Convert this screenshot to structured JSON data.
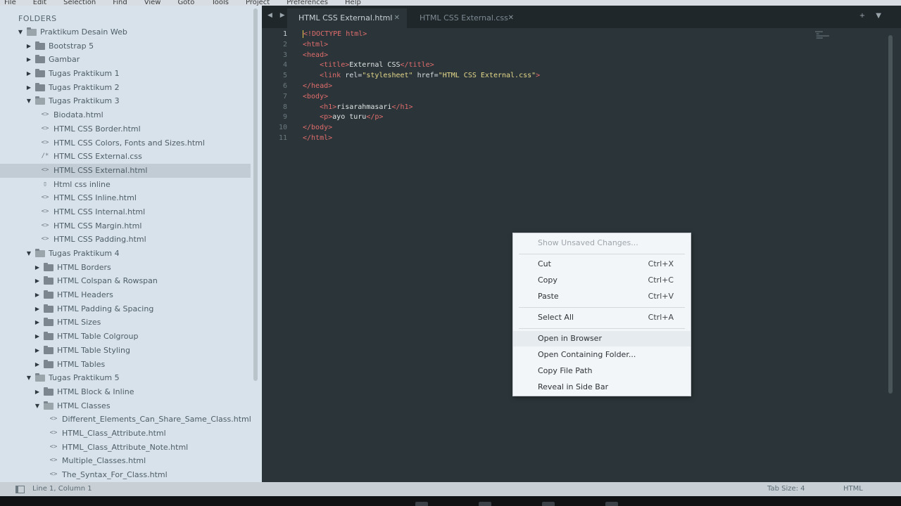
{
  "menubar": {
    "items": [
      "File",
      "Edit",
      "Selection",
      "Find",
      "View",
      "Goto",
      "Tools",
      "Project",
      "Preferences",
      "Help"
    ]
  },
  "sidebar": {
    "header": "FOLDERS",
    "tree": [
      {
        "label": "Praktikum Desain Web",
        "kind": "folder",
        "depth": 0,
        "open": true
      },
      {
        "label": "Bootstrap 5",
        "kind": "folder",
        "depth": 1,
        "open": false
      },
      {
        "label": "Gambar",
        "kind": "folder",
        "depth": 1,
        "open": false
      },
      {
        "label": "Tugas Praktikum 1",
        "kind": "folder",
        "depth": 1,
        "open": false
      },
      {
        "label": "Tugas Praktikum 2",
        "kind": "folder",
        "depth": 1,
        "open": false
      },
      {
        "label": "Tugas Praktikum 3",
        "kind": "folder",
        "depth": 1,
        "open": true
      },
      {
        "label": "Biodata.html",
        "kind": "html",
        "depth": 2
      },
      {
        "label": "HTML CSS Border.html",
        "kind": "html",
        "depth": 2
      },
      {
        "label": "HTML CSS Colors, Fonts and Sizes.html",
        "kind": "html",
        "depth": 2
      },
      {
        "label": "HTML CSS External.css",
        "kind": "css",
        "depth": 2
      },
      {
        "label": "HTML CSS External.html",
        "kind": "html",
        "depth": 2,
        "selected": true
      },
      {
        "label": "Html css inline",
        "kind": "plain",
        "depth": 2
      },
      {
        "label": "HTML CSS Inline.html",
        "kind": "html",
        "depth": 2
      },
      {
        "label": "HTML CSS Internal.html",
        "kind": "html",
        "depth": 2
      },
      {
        "label": "HTML CSS Margin.html",
        "kind": "html",
        "depth": 2
      },
      {
        "label": "HTML CSS Padding.html",
        "kind": "html",
        "depth": 2
      },
      {
        "label": "Tugas Praktikum 4",
        "kind": "folder",
        "depth": 1,
        "open": true
      },
      {
        "label": "HTML Borders",
        "kind": "folder",
        "depth": 2,
        "open": false
      },
      {
        "label": "HTML Colspan & Rowspan",
        "kind": "folder",
        "depth": 2,
        "open": false
      },
      {
        "label": "HTML Headers",
        "kind": "folder",
        "depth": 2,
        "open": false
      },
      {
        "label": "HTML Padding & Spacing",
        "kind": "folder",
        "depth": 2,
        "open": false
      },
      {
        "label": "HTML Sizes",
        "kind": "folder",
        "depth": 2,
        "open": false
      },
      {
        "label": "HTML Table Colgroup",
        "kind": "folder",
        "depth": 2,
        "open": false
      },
      {
        "label": "HTML Table Styling",
        "kind": "folder",
        "depth": 2,
        "open": false
      },
      {
        "label": "HTML Tables",
        "kind": "folder",
        "depth": 2,
        "open": false
      },
      {
        "label": "Tugas Praktikum 5",
        "kind": "folder",
        "depth": 1,
        "open": true
      },
      {
        "label": "HTML Block & Inline",
        "kind": "folder",
        "depth": 2,
        "open": false
      },
      {
        "label": "HTML Classes",
        "kind": "folder",
        "depth": 2,
        "open": true
      },
      {
        "label": "Different_Elements_Can_Share_Same_Class.html",
        "kind": "html",
        "depth": 3
      },
      {
        "label": "HTML_Class_Attribute.html",
        "kind": "html",
        "depth": 3
      },
      {
        "label": "HTML_Class_Attribute_Note.html",
        "kind": "html",
        "depth": 3
      },
      {
        "label": "Multiple_Classes.html",
        "kind": "html",
        "depth": 3
      },
      {
        "label": "The_Syntax_For_Class.html",
        "kind": "html",
        "depth": 3
      }
    ]
  },
  "tabs": {
    "nav_label": "◀ ▶",
    "right_label": "+ ▼",
    "items": [
      {
        "label": "HTML CSS External.html",
        "active": true
      },
      {
        "label": "HTML CSS External.css",
        "active": false
      }
    ]
  },
  "editor": {
    "current_line": 1,
    "lines": [
      [
        [
          "t",
          "<!DOCTYPE html>"
        ]
      ],
      [
        [
          "t",
          "<html>"
        ]
      ],
      [
        [
          "t",
          "<head>"
        ]
      ],
      [
        [
          "x",
          "    "
        ],
        [
          "t",
          "<title>"
        ],
        [
          "x",
          "External CSS"
        ],
        [
          "t",
          "</title>"
        ]
      ],
      [
        [
          "x",
          "    "
        ],
        [
          "t",
          "<link "
        ],
        [
          "a",
          "rel="
        ],
        [
          "s",
          "\"stylesheet\""
        ],
        [
          "a",
          " href="
        ],
        [
          "s",
          "\"HTML CSS External.css\""
        ],
        [
          "t",
          ">"
        ]
      ],
      [
        [
          "t",
          "</head>"
        ]
      ],
      [
        [
          "t",
          "<body>"
        ]
      ],
      [
        [
          "x",
          "    "
        ],
        [
          "t",
          "<h1>"
        ],
        [
          "x",
          "risarahmasari"
        ],
        [
          "t",
          "</h1>"
        ]
      ],
      [
        [
          "x",
          "    "
        ],
        [
          "t",
          "<p>"
        ],
        [
          "x",
          "ayo turu"
        ],
        [
          "t",
          "</p>"
        ]
      ],
      [
        [
          "t",
          "</body>"
        ]
      ],
      [
        [
          "t",
          "</html>"
        ]
      ]
    ]
  },
  "context_menu": {
    "items": [
      {
        "label": "Show Unsaved Changes...",
        "shortcut": "",
        "disabled": true
      },
      {
        "sep": true
      },
      {
        "label": "Cut",
        "shortcut": "Ctrl+X"
      },
      {
        "label": "Copy",
        "shortcut": "Ctrl+C"
      },
      {
        "label": "Paste",
        "shortcut": "Ctrl+V"
      },
      {
        "sep": true
      },
      {
        "label": "Select All",
        "shortcut": "Ctrl+A"
      },
      {
        "sep": true
      },
      {
        "label": "Open in Browser",
        "shortcut": "",
        "hover": true
      },
      {
        "label": "Open Containing Folder...",
        "shortcut": ""
      },
      {
        "label": "Copy File Path",
        "shortcut": ""
      },
      {
        "label": "Reveal in Side Bar",
        "shortcut": ""
      }
    ]
  },
  "statusbar": {
    "position": "Line 1, Column 1",
    "tab_size": "Tab Size: 4",
    "syntax": "HTML"
  },
  "colors": {
    "tag": "#e06c6c",
    "string": "#e5d88a",
    "sidebar_bg": "#d8e2ea",
    "editor_bg": "#2b3539"
  }
}
